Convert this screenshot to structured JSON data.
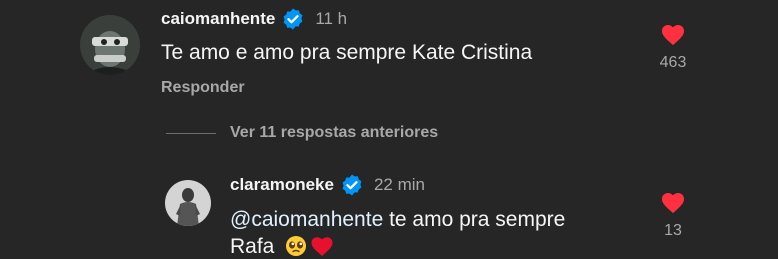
{
  "comment": {
    "username": "caiomanhente",
    "time": "11 h",
    "text": "Te amo e amo pra sempre Kate Cristina",
    "reply_label": "Responder",
    "like_count": "463",
    "verified": true,
    "avatar_icon": "profile-photo-icon",
    "like_icon": "heart-filled-icon",
    "like_color": "#ff3040"
  },
  "view_replies": {
    "label": "Ver 11 respostas anteriores"
  },
  "reply": {
    "username": "claramoneke",
    "time": "22 min",
    "mention": "@caiomanhente",
    "text_after_mention": " te amo pra sempre",
    "text_line2": "Rafa",
    "emojis": [
      "pleading-face-emoji",
      "red-heart-emoji"
    ],
    "like_count": "13",
    "verified": true,
    "avatar_icon": "profile-photo-icon",
    "like_icon": "heart-filled-icon",
    "like_color": "#ff3040"
  },
  "colors": {
    "background": "#262626",
    "primary_text": "#f5f5f5",
    "secondary_text": "#a8a8a8",
    "verified_badge": "#0095f6",
    "like": "#ff3040"
  }
}
